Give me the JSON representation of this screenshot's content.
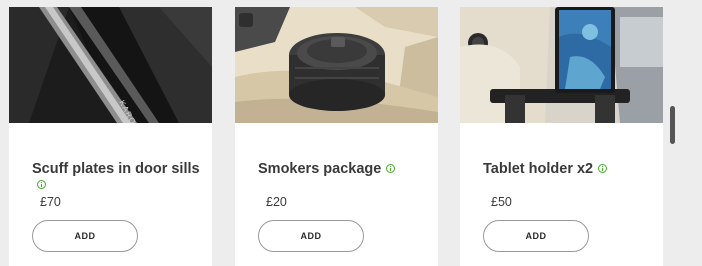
{
  "accessories": [
    {
      "title": "Scuff plates in door sills",
      "price": "£70",
      "button_label": "ADD",
      "info_icon": "info-icon",
      "image_subject": "scuff-plate",
      "image_text": "KAROQ"
    },
    {
      "title": "Smokers package",
      "price": "£20",
      "button_label": "ADD",
      "info_icon": "info-icon",
      "image_subject": "ashtray-cup"
    },
    {
      "title": "Tablet holder x2",
      "price": "£50",
      "button_label": "ADD",
      "info_icon": "info-icon",
      "image_subject": "tablet-holder"
    }
  ],
  "colors": {
    "accent_info": "#4ba82e",
    "page_background": "#ededed",
    "card_background": "#ffffff",
    "text": "#3a3a3a"
  }
}
